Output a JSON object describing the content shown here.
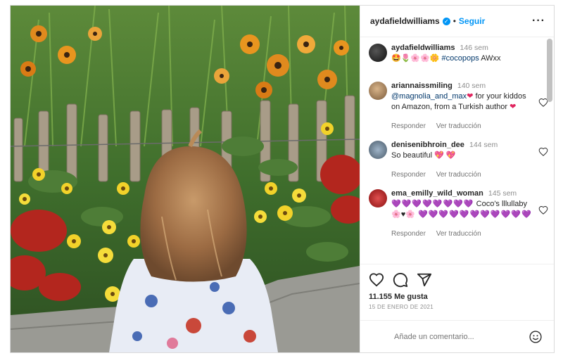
{
  "header": {
    "username": "aydafieldwilliams",
    "separator": "•",
    "follow_label": "Seguir",
    "more_label": "···"
  },
  "caption": {
    "username": "aydafieldwilliams",
    "time": "146 sem",
    "emojis": "🤩🌷🌸🌸🌼",
    "hashtag": "#cocopops",
    "suffix": "AWxx"
  },
  "comments": [
    {
      "username": "ariannaissmiling",
      "time": "140 sem",
      "mention": "@magnolia_and_max",
      "text_a": "❤",
      "text_b": " for your kiddos on Amazon, from a Turkish author ",
      "text_c": "❤",
      "reply_label": "Responder",
      "translate_label": "Ver traducción"
    },
    {
      "username": "denisenibhroin_dee",
      "time": "144 sem",
      "text": "So beautiful 💖 💖",
      "reply_label": "Responder",
      "translate_label": "Ver traducción"
    },
    {
      "username": "ema_emilly_wild_woman",
      "time": "145 sem",
      "hearts_a": "💜💜💜💜💜💜💜💜",
      "text_b": " Coco's lllullaby ",
      "emojis_c": "🌸♥🌸",
      "hearts_d": " 💜💜💜💜💜💜💜💜💜💜💜",
      "reply_label": "Responder",
      "translate_label": "Ver traducción"
    }
  ],
  "likes": "11.155 Me gusta",
  "date": "15 DE ENERO DE 2021",
  "add_comment": {
    "placeholder": "Añade un comentario..."
  },
  "colors": {
    "accent": "#0095f6",
    "text": "#262626",
    "muted": "#8e8e8e",
    "border": "#dbdbdb"
  }
}
